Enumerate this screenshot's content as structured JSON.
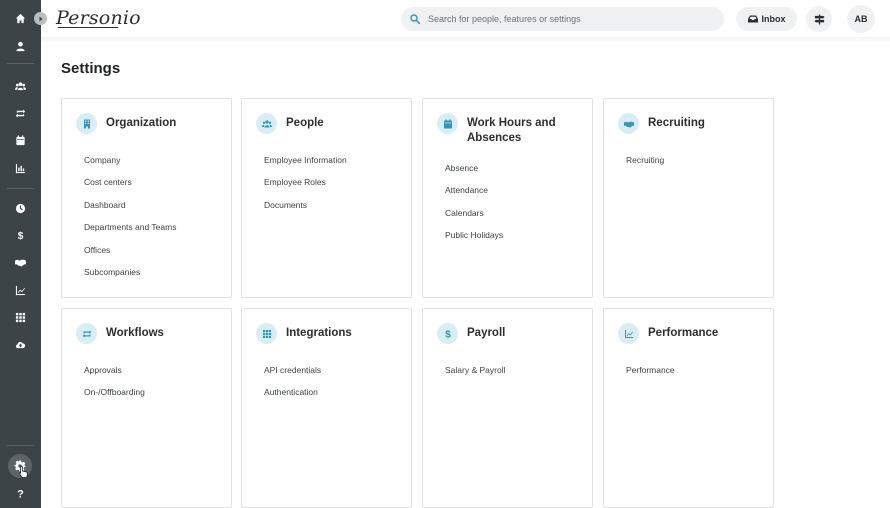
{
  "app": {
    "logo": "Personio"
  },
  "search": {
    "placeholder": "Search for people, features or settings"
  },
  "header": {
    "inbox_label": "Inbox",
    "avatar_initials": "AB"
  },
  "page": {
    "title": "Settings"
  },
  "cards": [
    {
      "title": "Organization",
      "icon": "building-icon",
      "items": [
        "Company",
        "Cost centers",
        "Dashboard",
        "Departments and Teams",
        "Offices",
        "Subcompanies"
      ]
    },
    {
      "title": "People",
      "icon": "people-icon",
      "items": [
        "Employee Information",
        "Employee Roles",
        "Documents"
      ]
    },
    {
      "title": "Work Hours and Absences",
      "icon": "calendar-icon",
      "items": [
        "Absence",
        "Attendance",
        "Calendars",
        "Public Holidays"
      ]
    },
    {
      "title": "Recruiting",
      "icon": "handshake-icon",
      "items": [
        "Recruiting"
      ]
    },
    {
      "title": "Workflows",
      "icon": "repeat-icon",
      "items": [
        "Approvals",
        "On-/Offboarding"
      ]
    },
    {
      "title": "Integrations",
      "icon": "grid-icon",
      "items": [
        "API credentials",
        "Authentication"
      ]
    },
    {
      "title": "Payroll",
      "icon": "dollar-icon",
      "items": [
        "Salary & Payroll"
      ]
    },
    {
      "title": "Performance",
      "icon": "chart-line-icon",
      "items": [
        "Performance"
      ]
    }
  ],
  "colors": {
    "sidebar": "#3d4448",
    "accent": "#3596b5",
    "icon_bg": "#d9edf5"
  }
}
